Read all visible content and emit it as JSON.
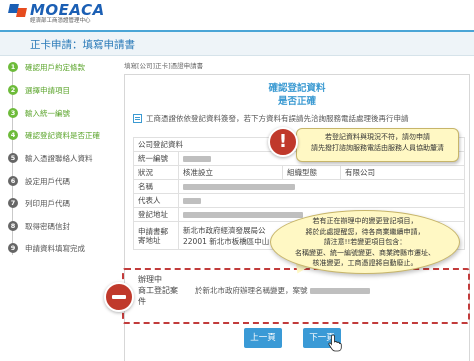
{
  "logo": {
    "name": "MOEACA",
    "subtitle": "經濟部工商憑證管理中心"
  },
  "header": {
    "title": "正卡申請：填寫申請書"
  },
  "breadcrumb": "填寫[公司]正卡]憑證申請書",
  "steps": [
    {
      "num": "1",
      "label": "確認用戶約定條款",
      "state": "done"
    },
    {
      "num": "2",
      "label": "選擇申請項目",
      "state": "done"
    },
    {
      "num": "3",
      "label": "輸入統一編號",
      "state": "done"
    },
    {
      "num": "4",
      "label": "確認登記資料是否正確",
      "state": "done"
    },
    {
      "num": "5",
      "label": "輸入憑證聯絡人資料",
      "state": "todo"
    },
    {
      "num": "6",
      "label": "設定用戶代碼",
      "state": "todo"
    },
    {
      "num": "7",
      "label": "列印用戶代碼",
      "state": "todo"
    },
    {
      "num": "8",
      "label": "取得密碼信封",
      "state": "todo"
    },
    {
      "num": "9",
      "label": "申請資料填寫完成",
      "state": "todo"
    }
  ],
  "card": {
    "heading_line1": "確認登記資料",
    "heading_line2": "是否正確",
    "notice": "工商憑證依依登記資料簽發，若下方資料有誤請先洽詢服務電話處理後再行申請"
  },
  "info_table": {
    "company_header": "公司登記資料",
    "id_label": "統一編號",
    "status_label": "狀況",
    "status_value": "核准設立",
    "org_type_label": "組織型態",
    "org_type_value": "有限公司",
    "name_label": "名稱",
    "rep_label": "代表人",
    "address_label": "登記地址",
    "authority_label": "申請書郵寄地址",
    "authority_value_line1": "新北市政府經濟發展局公",
    "authority_value_line2": "22001 新北市板橋區中山"
  },
  "case": {
    "label_line1": "辦理中",
    "label_line2": "商工登記案",
    "label_line3": "件",
    "value": "於新北市政府辦理名稱變更，案號"
  },
  "callout1": {
    "line1": "若登記資料與現況不符，請勿申請",
    "line2": "請先撥打諮詢服務電話由服務人員協助釐清"
  },
  "callout2": {
    "line1": "若有正在辦理中的變更登記項目，",
    "line2": "將於此處提醒您，待各商業繼續申請，",
    "line3": "請注意!!若變更項目包含：",
    "line4": "名稱變更、統一編號變更、商業跨縣市遷址、",
    "line5": "核准變更，工商憑證將自動廢止。"
  },
  "buttons": {
    "prev": "上一頁",
    "next": "下一頁"
  },
  "icons": {
    "warning": "exclamation-icon",
    "minus": "minus-icon",
    "notice": "document-icon",
    "cursor": "hand-cursor-icon"
  },
  "colors": {
    "accent": "#3a9ad6",
    "done": "#6dbb3a",
    "alert": "#c0392b",
    "callout": "#fff8c4"
  }
}
